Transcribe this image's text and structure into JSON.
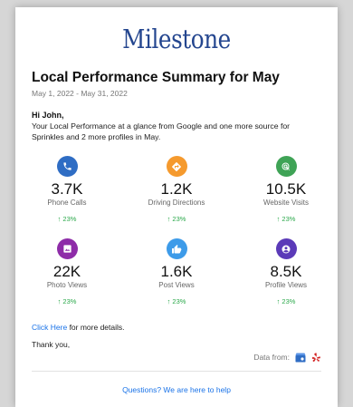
{
  "brand": {
    "logo_text": "Milestone",
    "logo_color": "#24468f"
  },
  "header": {
    "title": "Local Performance Summary for May",
    "date_range": "May 1, 2022 - May 31, 2022"
  },
  "message": {
    "greeting": "Hi John,",
    "intro": "Your Local Performance at a glance from Google and one more source for Sprinkles and 2 more profiles in May."
  },
  "metrics": [
    {
      "icon": "phone-icon",
      "color": "#2f6dc4",
      "value": "3.7K",
      "label": "Phone Calls",
      "change": "↑ 23%"
    },
    {
      "icon": "directions-icon",
      "color": "#f59a2e",
      "value": "1.2K",
      "label": "Driving Directions",
      "change": "↑ 23%"
    },
    {
      "icon": "website-click-icon",
      "color": "#3fa356",
      "value": "10.5K",
      "label": "Website Visits",
      "change": "↑ 23%"
    },
    {
      "icon": "photo-icon",
      "color": "#8e2ca8",
      "value": "22K",
      "label": "Photo Views",
      "change": "↑ 23%"
    },
    {
      "icon": "thumbs-up-icon",
      "color": "#3d9be9",
      "value": "1.6K",
      "label": "Post Views",
      "change": "↑ 23%"
    },
    {
      "icon": "profile-icon",
      "color": "#5b3ab8",
      "value": "8.5K",
      "label": "Profile Views",
      "change": "↑ 23%"
    }
  ],
  "footer": {
    "link_text": "Click Here",
    "more_text": " for more details.",
    "thanks": "Thank you,",
    "data_from": "Data from:",
    "sources": [
      "google-business-icon",
      "yelp-icon"
    ],
    "help_link": "Questions? We are here to help"
  },
  "colors": {
    "positive_change": "#2aa84a",
    "link": "#1a73e8"
  }
}
